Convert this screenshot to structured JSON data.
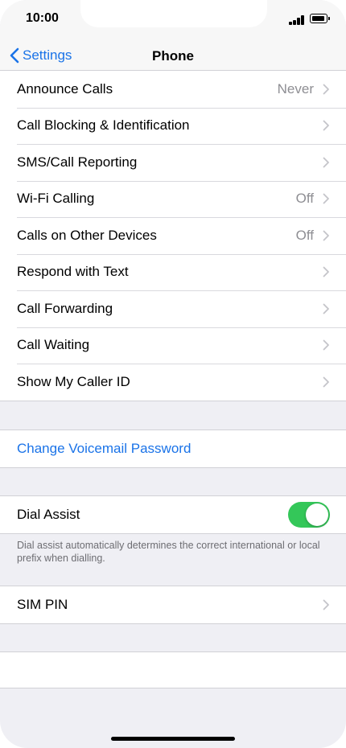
{
  "status": {
    "time": "10:00"
  },
  "nav": {
    "back_label": "Settings",
    "title": "Phone"
  },
  "group1": [
    {
      "label": "Announce Calls",
      "value": "Never"
    },
    {
      "label": "Call Blocking & Identification",
      "value": ""
    },
    {
      "label": "SMS/Call Reporting",
      "value": ""
    },
    {
      "label": "Wi-Fi Calling",
      "value": "Off"
    },
    {
      "label": "Calls on Other Devices",
      "value": "Off"
    },
    {
      "label": "Respond with Text",
      "value": ""
    },
    {
      "label": "Call Forwarding",
      "value": ""
    },
    {
      "label": "Call Waiting",
      "value": ""
    },
    {
      "label": "Show My Caller ID",
      "value": ""
    }
  ],
  "voicemail": {
    "label": "Change Voicemail Password"
  },
  "dial_assist": {
    "label": "Dial Assist",
    "enabled": true,
    "footer": "Dial assist automatically determines the correct international or local prefix when dialling."
  },
  "sim_pin": {
    "label": "SIM PIN"
  },
  "colors": {
    "accent": "#1a73e8",
    "toggle_on": "#34c759"
  }
}
